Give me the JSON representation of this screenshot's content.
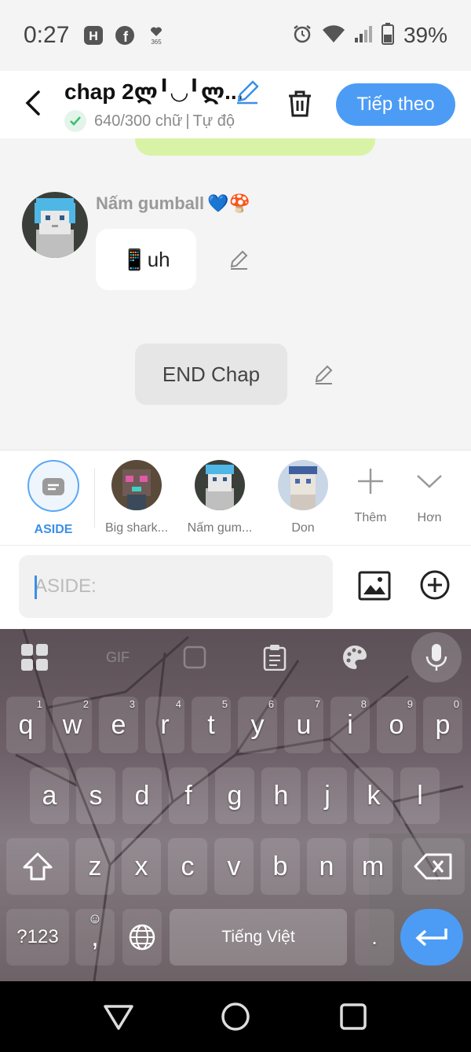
{
  "status_bar": {
    "time": "0:27",
    "battery": "39%",
    "left_icons": [
      "h-app-icon",
      "facebook-icon",
      "heart-365-icon"
    ],
    "right_icons": [
      "alarm-icon",
      "wifi-icon",
      "signal-icon",
      "battery-icon"
    ]
  },
  "header": {
    "title": "chap 2ლ╹◡╹ლ...",
    "word_count": "640/300 chữ",
    "separator": "|",
    "mode": "Tự độ",
    "next_label": "Tiếp theo"
  },
  "chat": {
    "sender_name": "Nấm gumball",
    "sender_emoji": "💙🍄",
    "message": "📱uh",
    "end_label": "END Chap"
  },
  "characters": {
    "items": [
      {
        "label": "ASIDE"
      },
      {
        "label": "Big shark..."
      },
      {
        "label": "Nấm gum..."
      },
      {
        "label": "Don"
      }
    ],
    "add_label": "Thêm",
    "more_label": "Hơn"
  },
  "input": {
    "placeholder": "ASIDE:",
    "value": ""
  },
  "keyboard": {
    "row1": [
      "q",
      "w",
      "e",
      "r",
      "t",
      "y",
      "u",
      "i",
      "o",
      "p"
    ],
    "row1_hints": [
      "1",
      "2",
      "3",
      "4",
      "5",
      "6",
      "7",
      "8",
      "9",
      "0"
    ],
    "row2": [
      "a",
      "s",
      "d",
      "f",
      "g",
      "h",
      "j",
      "k",
      "l"
    ],
    "row3": [
      "z",
      "x",
      "c",
      "v",
      "b",
      "n",
      "m"
    ],
    "sym_label": "?123",
    "comma_label": ",",
    "space_label": "Tiếng Việt",
    "period_label": ".",
    "gif_label": "GIF"
  },
  "colors": {
    "accent": "#4c9cf5",
    "green_chip": "#d9f3a6",
    "background": "#f4f4f4"
  }
}
